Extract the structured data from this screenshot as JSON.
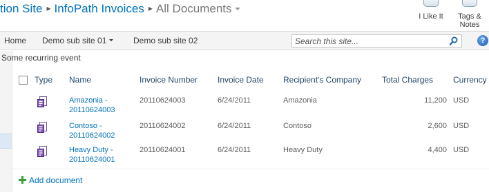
{
  "breadcrumb": {
    "site": "tion Site",
    "separator": "▸",
    "library": "InfoPath Invoices",
    "view": "All Documents"
  },
  "social": {
    "like_label": "I Like It",
    "tags_label_line1": "Tags &",
    "tags_label_line2": "Notes"
  },
  "topnav": {
    "items": [
      "Home",
      "Demo sub site 01",
      "Demo sub site 02"
    ]
  },
  "search": {
    "placeholder": "Search this site..."
  },
  "help": {
    "label": "?"
  },
  "quicklaunch": {
    "event_link": "Some recurring event"
  },
  "list": {
    "columns": [
      "Type",
      "Name",
      "Invoice Number",
      "Invoice Date",
      "Recipient's Company",
      "Total Charges",
      "Currency"
    ],
    "rows": [
      {
        "name_line1": "Amazonia -",
        "name_line2": "20110624003",
        "invoice_number": "20110624003",
        "invoice_date": "6/24/2011",
        "company": "Amazonia",
        "total": "11,200",
        "currency": "USD"
      },
      {
        "name_line1": "Contoso -",
        "name_line2": "20110624002",
        "invoice_number": "20110624002",
        "invoice_date": "6/24/2011",
        "company": "Contoso",
        "total": "2,600",
        "currency": "USD"
      },
      {
        "name_line1": "Heavy Duty -",
        "name_line2": "20110624001",
        "invoice_number": "20110624001",
        "invoice_date": "6/24/2011",
        "company": "Heavy Duty",
        "total": "4,400",
        "currency": "USD"
      }
    ],
    "add_label": "Add document"
  },
  "colors": {
    "link": "#0072bc",
    "header_text": "#23466c",
    "nav_bg": "#f4f4f4",
    "add_icon": "#3aa13a"
  }
}
